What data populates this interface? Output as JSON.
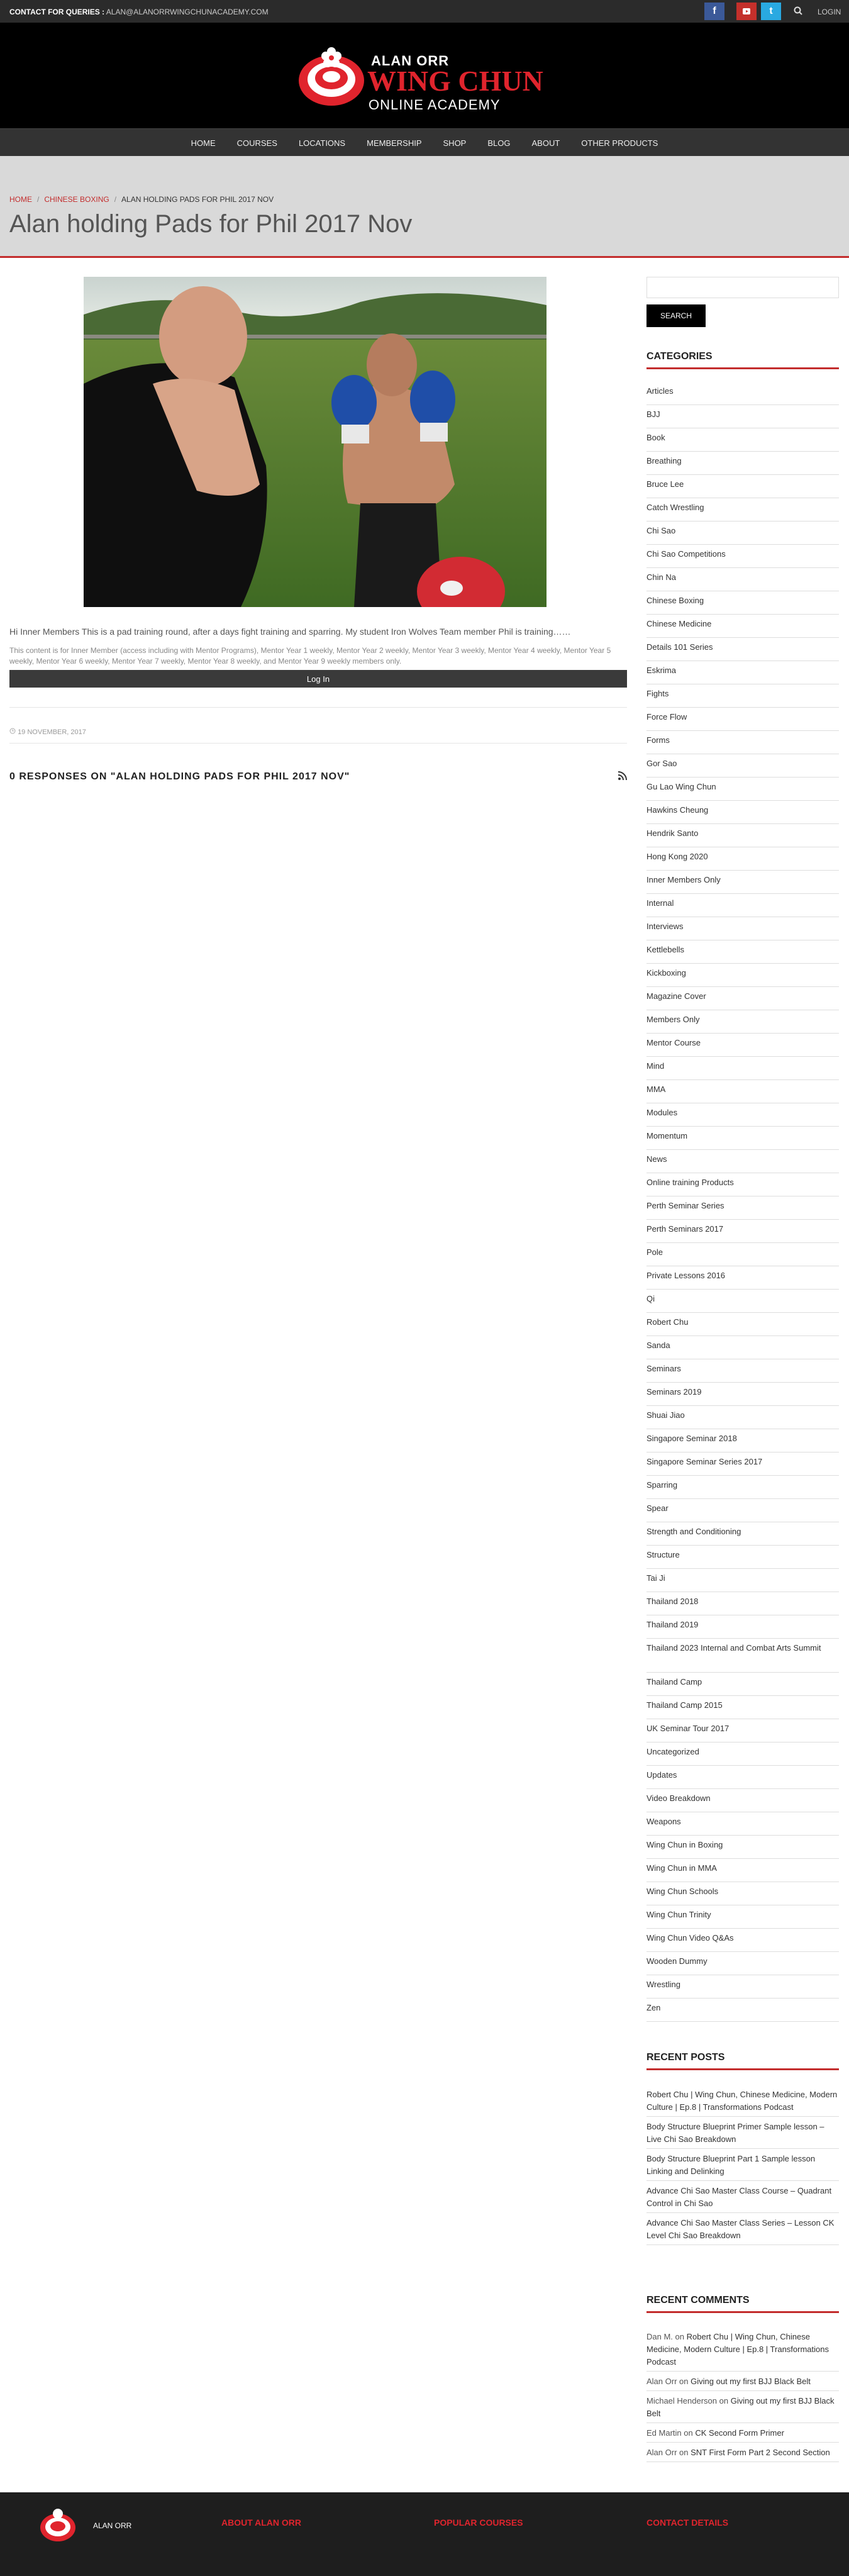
{
  "topbar": {
    "contact_label": "CONTACT FOR QUERIES :",
    "contact_email": "ALAN@ALANORRWINGCHUNACADEMY.COM",
    "login": "LOGIN"
  },
  "logo": {
    "line1": "ALAN ORR",
    "line2": "WING CHUN",
    "line3": "ONLINE ACADEMY"
  },
  "nav": [
    "HOME",
    "COURSES",
    "LOCATIONS",
    "MEMBERSHIP",
    "SHOP",
    "BLOG",
    "ABOUT",
    "OTHER PRODUCTS"
  ],
  "breadcrumb": {
    "home": "HOME",
    "category": "CHINESE BOXING",
    "current": "ALAN HOLDING PADS FOR PHIL 2017 NOV"
  },
  "page_title": "Alan holding Pads for Phil 2017 Nov",
  "post": {
    "excerpt": "Hi Inner Members This is a pad training round, after a days fight training and sparring. My student Iron Wolves Team member Phil is training……",
    "restriction": "This content is for Inner Member (access including with Mentor Programs), Mentor Year 1 weekly, Mentor Year 2 weekly, Mentor Year 3 weekly, Mentor Year 4 weekly, Mentor Year 5 weekly, Mentor Year 6 weekly, Mentor Year 7 weekly, Mentor Year 8 weekly, and Mentor Year 9 weekly members only.",
    "login_button": "Log In",
    "date": "19 NOVEMBER, 2017",
    "responses": "0 RESPONSES ON \"ALAN HOLDING PADS FOR PHIL 2017 NOV\""
  },
  "sidebar": {
    "search_button": "SEARCH",
    "categories_title": "CATEGORIES",
    "categories": [
      "Articles",
      "BJJ",
      "Book",
      "Breathing",
      "Bruce Lee",
      "Catch Wrestling",
      "Chi Sao",
      "Chi Sao Competitions",
      "Chin Na",
      "Chinese Boxing",
      "Chinese Medicine",
      "Details 101 Series",
      "Eskrima",
      "Fights",
      "Force Flow",
      "Forms",
      "Gor Sao",
      "Gu Lao Wing Chun",
      "Hawkins Cheung",
      "Hendrik Santo",
      "Hong Kong 2020",
      "Inner Members Only",
      "Internal",
      "Interviews",
      "Kettlebells",
      "Kickboxing",
      "Magazine Cover",
      "Members Only",
      "Mentor Course",
      "Mind",
      "MMA",
      "Modules",
      "Momentum",
      "News",
      "Online training Products",
      "Perth Seminar Series",
      "Perth Seminars 2017",
      "Pole",
      "Private Lessons 2016",
      "Qi",
      "Robert Chu",
      "Sanda",
      "Seminars",
      "Seminars 2019",
      "Shuai Jiao",
      "Singapore Seminar 2018",
      "Singapore Seminar Series 2017",
      "Sparring",
      "Spear",
      "Strength and Conditioning",
      "Structure",
      "Tai Ji",
      "Thailand 2018",
      "Thailand 2019",
      "Thailand 2023 Internal and Combat Arts Summit",
      "Thailand Camp",
      "Thailand Camp 2015",
      "UK Seminar Tour 2017",
      "Uncategorized",
      "Updates",
      "Video Breakdown",
      "Weapons",
      "Wing Chun in Boxing",
      "Wing Chun in MMA",
      "Wing Chun Schools",
      "Wing Chun Trinity",
      "Wing Chun Video Q&As",
      "Wooden Dummy",
      "Wrestling",
      "Zen"
    ],
    "recent_posts_title": "RECENT POSTS",
    "recent_posts": [
      "Robert Chu | Wing Chun, Chinese Medicine, Modern Culture | Ep.8 | Transformations Podcast",
      "Body Structure Blueprint Primer Sample lesson – Live Chi Sao Breakdown",
      "Body Structure Blueprint Part 1 Sample lesson Linking and Delinking",
      "Advance Chi Sao Master Class Course – Quadrant Control in Chi Sao",
      "Advance Chi Sao Master Class Series – Lesson CK Level Chi Sao Breakdown"
    ],
    "recent_comments_title": "RECENT COMMENTS",
    "recent_comments": [
      {
        "author": "Dan M.",
        "on": "on",
        "post": "Robert Chu | Wing Chun, Chinese Medicine, Modern Culture | Ep.8 | Transformations Podcast"
      },
      {
        "author": "Alan Orr",
        "on": "on",
        "post": "Giving out my first BJJ Black Belt"
      },
      {
        "author": "Michael Henderson",
        "on": "on",
        "post": "Giving out my first BJJ Black Belt"
      },
      {
        "author": "Ed Martin",
        "on": "on",
        "post": "CK Second Form Primer"
      },
      {
        "author": "Alan Orr",
        "on": "on",
        "post": "SNT First Form Part 2 Second Section"
      }
    ]
  },
  "footer": {
    "logo_text": "ALAN ORR",
    "col1": "ABOUT ALAN ORR",
    "col2": "POPULAR COURSES",
    "col3": "CONTACT DETAILS"
  },
  "colors": {
    "accent": "#c32d2d",
    "brand_red": "#e0242d",
    "header_bg": "#000000",
    "nav_bg": "#333333",
    "facebook": "#3b5998",
    "youtube": "#c4302b",
    "twitter": "#29a9e1"
  },
  "icons": [
    "facebook-icon",
    "youtube-icon",
    "twitter-icon",
    "search-icon",
    "clock-icon",
    "rss-icon",
    "logo-mark-icon"
  ]
}
